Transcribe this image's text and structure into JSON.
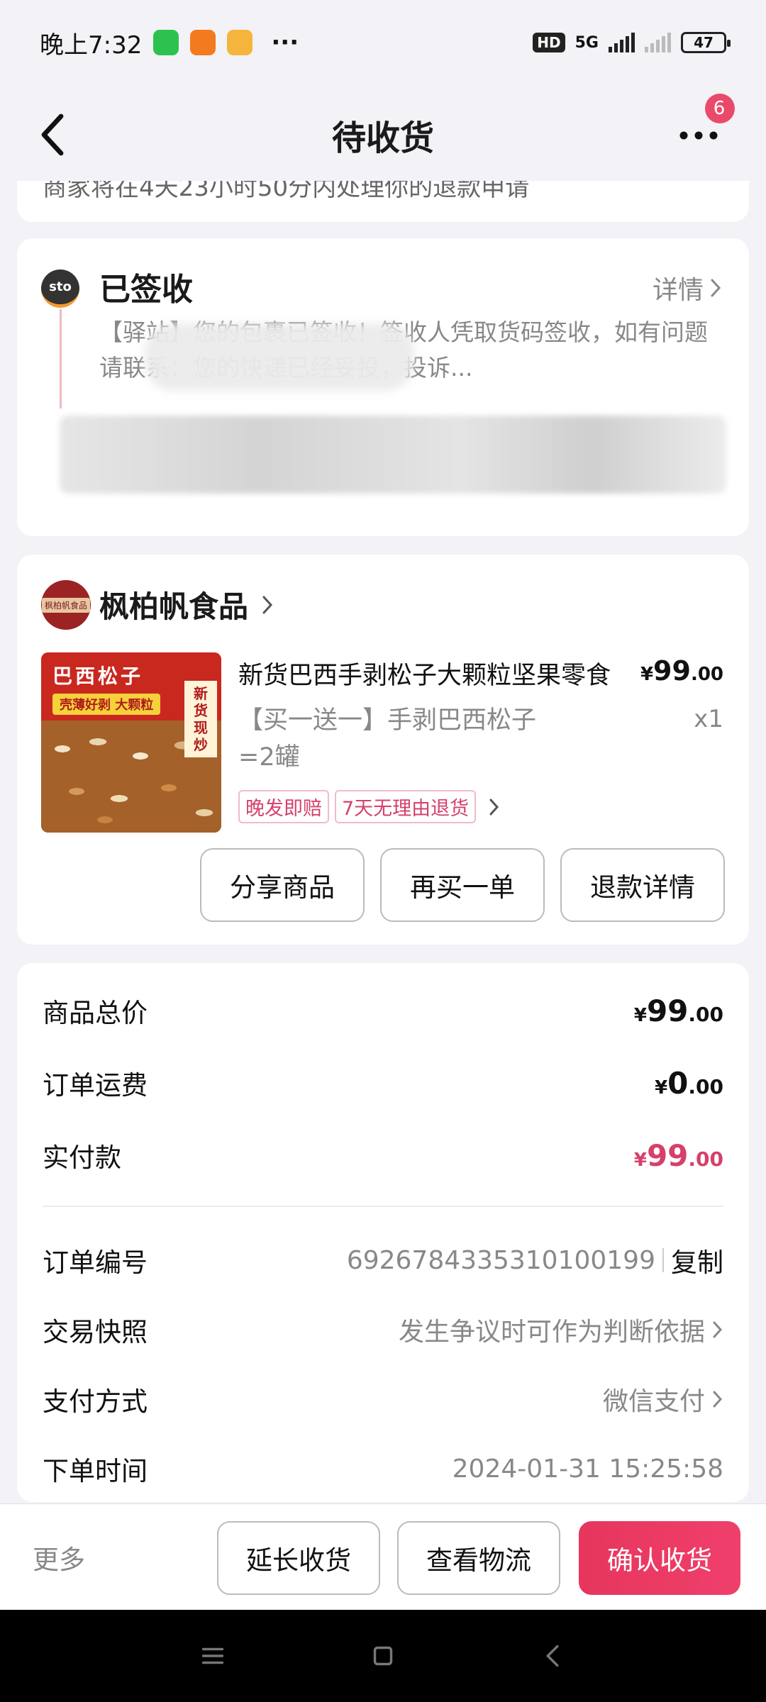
{
  "status_bar": {
    "time": "晚上7:32",
    "more": "···",
    "hd": "HD",
    "network": "5G",
    "battery": "47"
  },
  "header": {
    "title": "待收货",
    "more_badge": "6"
  },
  "notice": {
    "text": "商家将在4天23小时50分内处理你的退款申请"
  },
  "logistics": {
    "carrier": "sto",
    "status": "已签收",
    "details_label": "详情",
    "description": "【驿站】您的包裹已签收！签收人凭取货码签收，如有问题请联系：您的快递已经妥投，投诉..."
  },
  "store": {
    "name": "枫柏帆食品",
    "logo_text": "枫柏帆食品"
  },
  "product": {
    "image_title": "巴西松子",
    "image_subtitle": "壳薄好剥 大颗粒",
    "image_side": "新货现炒",
    "title": "新货巴西手剥松子大颗粒坚果零食",
    "price_currency": "¥",
    "price_int": "99",
    "price_dec": ".00",
    "spec": "【买一送一】手剥巴西松子=2罐",
    "qty": "x1",
    "tags": [
      "晚发即赔",
      "7天无理由退货"
    ]
  },
  "product_actions": {
    "share": "分享商品",
    "rebuy": "再买一单",
    "refund_details": "退款详情"
  },
  "order": {
    "goods_total_label": "商品总价",
    "goods_total": {
      "cur": "¥",
      "int": "99",
      "dec": ".00"
    },
    "shipping_label": "订单运费",
    "shipping": {
      "cur": "¥",
      "int": "0",
      "dec": ".00"
    },
    "paid_label": "实付款",
    "paid": {
      "cur": "¥",
      "int": "99",
      "dec": ".00"
    },
    "order_no_label": "订单编号",
    "order_no": "6926784335310100199",
    "copy_label": "复制",
    "snapshot_label": "交易快照",
    "snapshot_value": "发生争议时可作为判断依据",
    "payment_label": "支付方式",
    "payment_value": "微信支付",
    "order_time_label": "下单时间",
    "order_time": "2024-01-31 15:25:58"
  },
  "action_bar": {
    "more": "更多",
    "extend": "延长收货",
    "logistics": "查看物流",
    "confirm": "确认收货"
  },
  "colors": {
    "accent": "#e7365d",
    "price_pink": "#d6406a",
    "background": "#f2f2f7"
  }
}
